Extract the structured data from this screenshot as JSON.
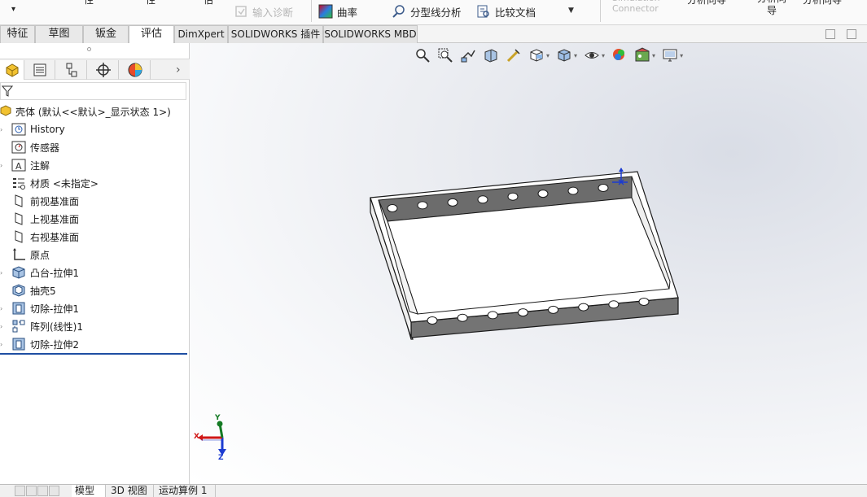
{
  "ribbon": {
    "fragments": {
      "frag_a": "性",
      "frag_b": "性",
      "frag_c": "估",
      "simulation_connector": "Simulation\nConnector",
      "analysis_wizard_1": "分析向导",
      "analysis_wizard_2": "分析向\n导",
      "analysis_wizard_3": "分析向导"
    },
    "import_diagnostics_label": "输入诊断",
    "curvature_label": "曲率",
    "parting_line_label": "分型线分析",
    "compare_documents_label": "比较文档"
  },
  "command_tabs": [
    {
      "label": "特征"
    },
    {
      "label": "草图"
    },
    {
      "label": "钣金"
    },
    {
      "label": "评估"
    },
    {
      "label": "DimXpert"
    },
    {
      "label": "SOLIDWORKS 插件"
    },
    {
      "label": "SOLIDWORKS MBD"
    }
  ],
  "feature_tree": {
    "root_label": "壳体 (默认<<默认>_显示状态 1>)",
    "items": [
      {
        "label": "History",
        "icon": "history-icon"
      },
      {
        "label": "传感器",
        "icon": "sensor-icon"
      },
      {
        "label": "注解",
        "icon": "annotation-icon"
      },
      {
        "label": "材质 <未指定>",
        "icon": "material-icon"
      },
      {
        "label": "前视基准面",
        "icon": "plane-icon"
      },
      {
        "label": "上视基准面",
        "icon": "plane-icon"
      },
      {
        "label": "右视基准面",
        "icon": "plane-icon"
      },
      {
        "label": "原点",
        "icon": "origin-icon"
      },
      {
        "label": "凸台-拉伸1",
        "icon": "boss-extrude-icon"
      },
      {
        "label": "抽壳5",
        "icon": "shell-icon"
      },
      {
        "label": "切除-拉伸1",
        "icon": "cut-extrude-icon"
      },
      {
        "label": "阵列(线性)1",
        "icon": "linear-pattern-icon"
      },
      {
        "label": "切除-拉伸2",
        "icon": "cut-extrude-icon"
      }
    ]
  },
  "triad": {
    "x": "X",
    "y": "Y",
    "z": "Z"
  },
  "bottom_tabs": [
    {
      "label": "模型"
    },
    {
      "label": "3D 视图"
    },
    {
      "label": "运动算例 1"
    }
  ],
  "colors": {
    "rollback_bar": "#1f4fa3",
    "part_wall": "#6b6b6b",
    "part_edge": "#1a1a1a"
  }
}
